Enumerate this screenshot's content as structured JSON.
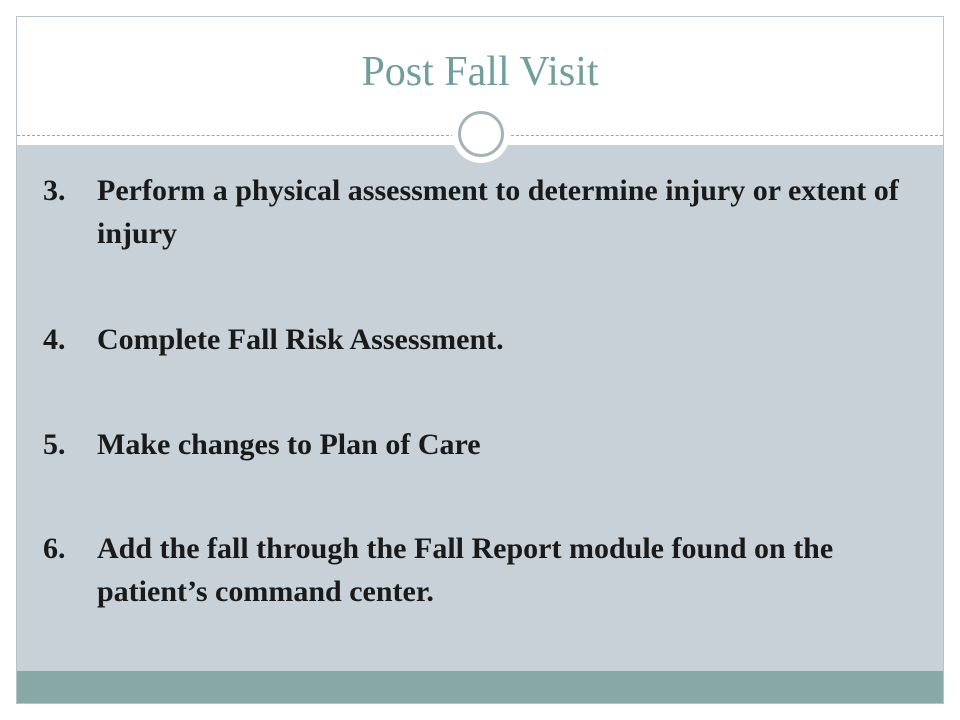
{
  "slide": {
    "title": "Post Fall Visit",
    "items": [
      {
        "number": "3.",
        "text": "Perform a physical assessment to determine injury or extent of injury"
      },
      {
        "number": "4.",
        "text": "Complete Fall Risk Assessment."
      },
      {
        "number": "5.",
        "text": "Make changes to Plan of Care"
      },
      {
        "number": "6.",
        "text": "Add the fall through the Fall Report module found on the patient’s command center."
      }
    ]
  },
  "colors": {
    "title": "#6f9e9c",
    "content_background": "#c7d1d7",
    "footer_bar": "#88a8a8",
    "circle_ring": "#a3b4b7"
  },
  "icons": {
    "divider_ornament": "circle-ornament-icon"
  }
}
